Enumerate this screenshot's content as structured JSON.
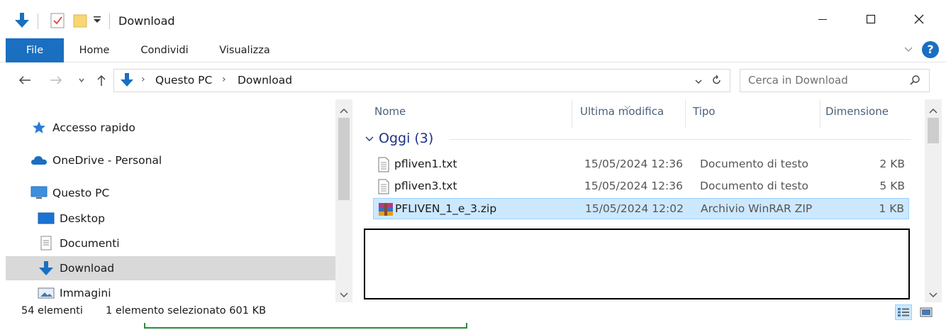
{
  "window": {
    "title": "Download"
  },
  "ribbon": {
    "tabs": [
      "File",
      "Home",
      "Condividi",
      "Visualizza"
    ]
  },
  "address": {
    "crumbs": [
      "Questo PC",
      "Download"
    ],
    "search_placeholder": "Cerca in Download"
  },
  "nav": {
    "items": [
      {
        "label": "Accesso rapido",
        "icon": "star-icon"
      },
      {
        "label": "OneDrive - Personal",
        "icon": "cloud-icon"
      },
      {
        "label": "Questo PC",
        "icon": "computer-icon"
      },
      {
        "label": "Desktop",
        "icon": "desktop-folder-icon"
      },
      {
        "label": "Documenti",
        "icon": "documents-folder-icon"
      },
      {
        "label": "Download",
        "icon": "download-folder-icon"
      },
      {
        "label": "Immagini",
        "icon": "pictures-folder-icon"
      }
    ],
    "selected": "Download"
  },
  "files": {
    "columns": [
      "Nome",
      "Ultima modifica",
      "Tipo",
      "Dimensione"
    ],
    "group": "Oggi (3)",
    "rows": [
      {
        "name": "pfliven1.txt",
        "date": "15/05/2024 12:36",
        "type": "Documento di testo",
        "size": "2 KB",
        "icon": "text-file-icon"
      },
      {
        "name": "pfliven3.txt",
        "date": "15/05/2024 12:36",
        "type": "Documento di testo",
        "size": "5 KB",
        "icon": "text-file-icon"
      },
      {
        "name": "PFLIVEN_1_e_3.zip",
        "date": "15/05/2024 12:02",
        "type": "Archivio WinRAR ZIP",
        "size": "1 KB",
        "icon": "winrar-archive-icon"
      }
    ],
    "selected_index": 2
  },
  "status": {
    "count": "54 elementi",
    "selection": "1 elemento selezionato  601 KB"
  },
  "colors": {
    "accent": "#1a6fc1",
    "selection": "#cce8ff",
    "group_header": "#1e3287"
  }
}
